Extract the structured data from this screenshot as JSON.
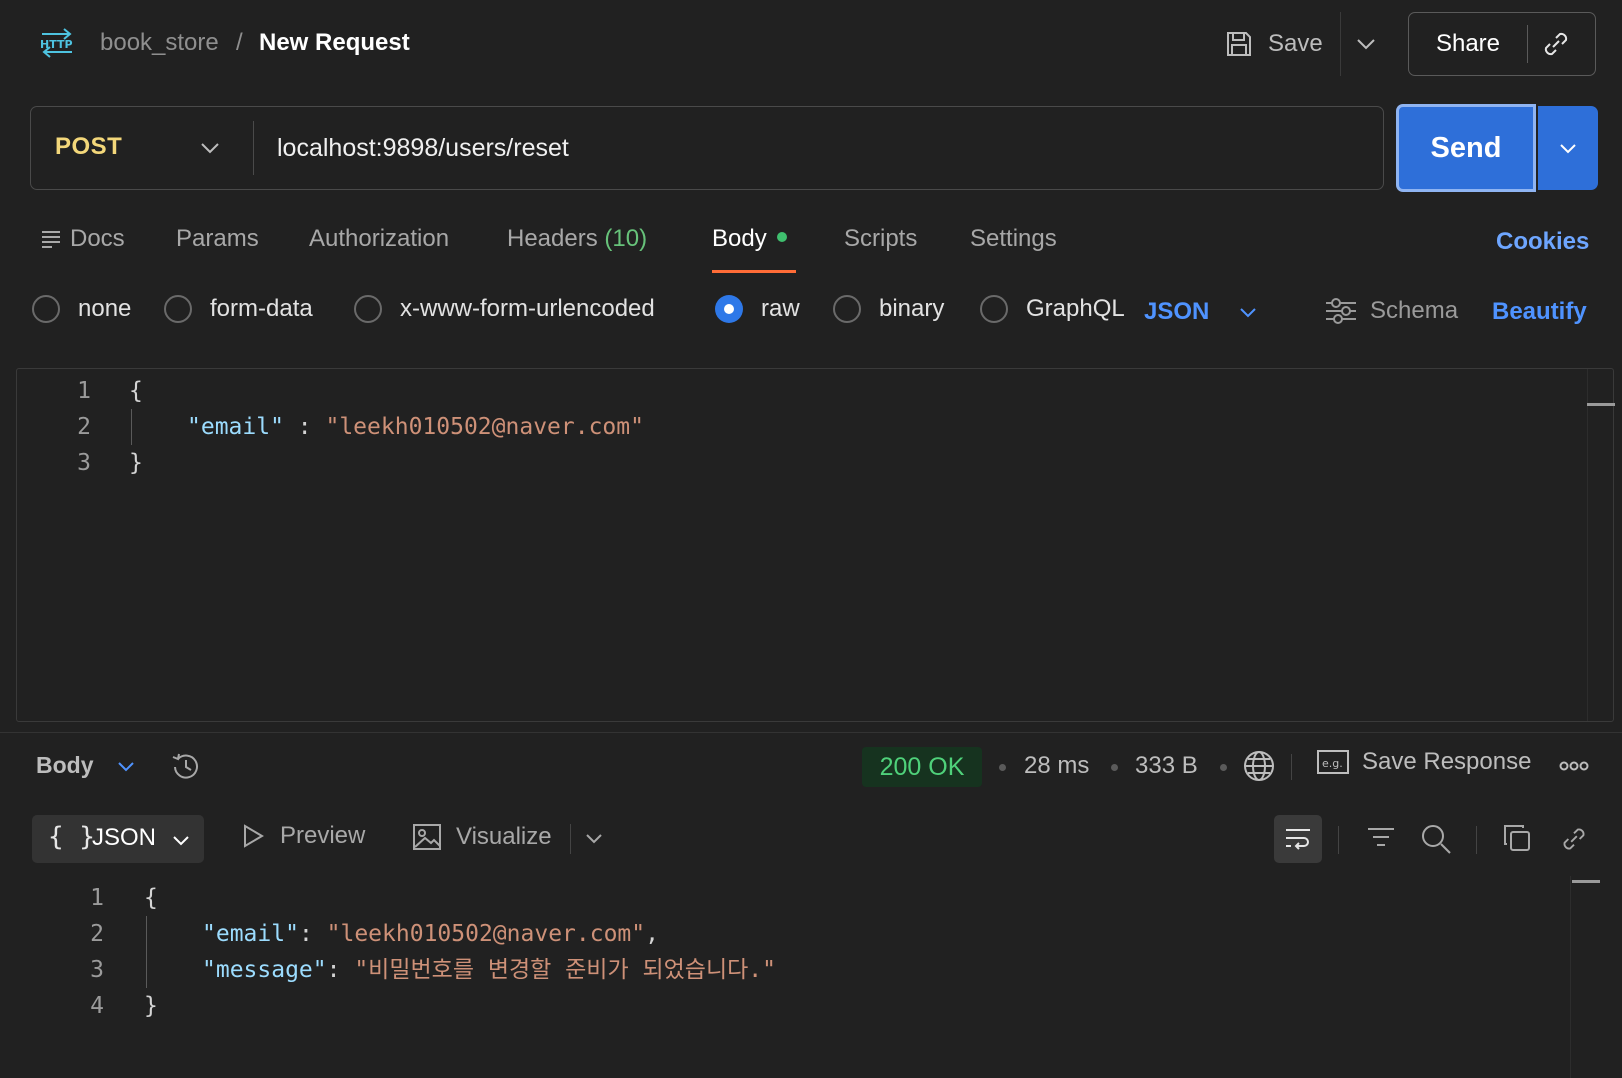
{
  "header": {
    "collection": "book_store",
    "separator": "/",
    "title": "New Request",
    "save_label": "Save",
    "share_label": "Share"
  },
  "request": {
    "method": "POST",
    "url": "localhost:9898/users/reset",
    "send_label": "Send"
  },
  "tabs": {
    "docs": "Docs",
    "params": "Params",
    "authorization": "Authorization",
    "headers": "Headers",
    "headers_count": "(10)",
    "body": "Body",
    "scripts": "Scripts",
    "settings": "Settings",
    "cookies": "Cookies"
  },
  "body_types": {
    "none": "none",
    "form_data": "form-data",
    "urlencoded": "x-www-form-urlencoded",
    "raw": "raw",
    "binary": "binary",
    "graphql": "GraphQL",
    "selected": "raw",
    "format": "JSON",
    "schema": "Schema",
    "beautify": "Beautify"
  },
  "request_body": {
    "line_numbers": [
      "1",
      "2",
      "3"
    ],
    "open_brace": "{",
    "key": "\"email\"",
    "colon": " : ",
    "value": "\"leekh010502@naver.com\"",
    "close_brace": "}"
  },
  "response": {
    "view_label": "Body",
    "status": "200 OK",
    "time": "28 ms",
    "size": "333 B",
    "save_response": "Save Response",
    "format": "JSON",
    "braces_glyph": "{ }",
    "preview": "Preview",
    "visualize": "Visualize",
    "line_numbers": [
      "1",
      "2",
      "3",
      "4"
    ],
    "open_brace": "{",
    "key1": "\"email\"",
    "colon1": ": ",
    "value1": "\"leekh010502@naver.com\"",
    "comma1": ",",
    "key2": "\"message\"",
    "colon2": ": ",
    "value2": "\"비밀번호를 변경할 준비가 되었습니다.\"",
    "close_brace": "}"
  },
  "colors": {
    "background": "#212121",
    "method_post": "#f3d77a",
    "send_button": "#2e6fd9",
    "accent_link": "#4f93ff",
    "active_tab_underline": "#ff6c37",
    "status_ok": "#4fd17a",
    "json_key": "#9cdcfe",
    "json_string": "#ce9178"
  },
  "icons": [
    "http-icon",
    "save-icon",
    "chevron-down-icon",
    "link-icon",
    "radio-icon",
    "schema-sliders-icon",
    "history-icon",
    "globe-icon",
    "example-icon",
    "more-icon",
    "play-icon",
    "image-icon",
    "wrap-icon",
    "filter-icon",
    "search-icon",
    "copy-icon"
  ]
}
